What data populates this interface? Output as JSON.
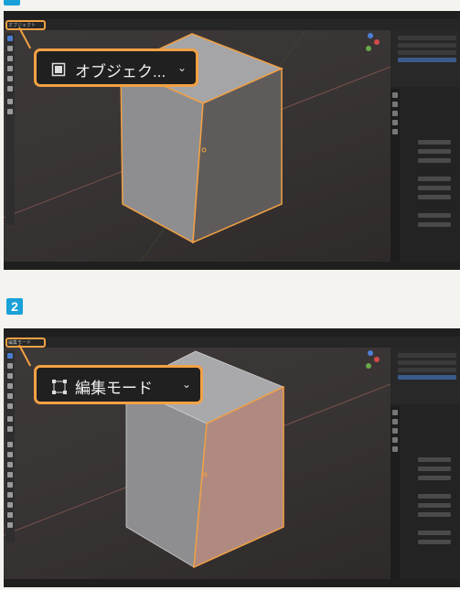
{
  "steps": [
    {
      "number": "",
      "mode_selector_small": "オブジェクト",
      "callout_label": "オブジェク...",
      "mode_icon": "object-mode-icon",
      "cube_state": "object-selected"
    },
    {
      "number": "2",
      "mode_selector_small": "編集モード",
      "callout_label": "編集モード",
      "mode_icon": "edit-mode-icon",
      "cube_state": "edit-face-selected"
    }
  ],
  "colors": {
    "highlight_orange": "#f2a144",
    "step_badge_blue": "#19a1d8",
    "viewport_bg": "#3a3535",
    "active_tool_blue": "#4a7bd0"
  }
}
